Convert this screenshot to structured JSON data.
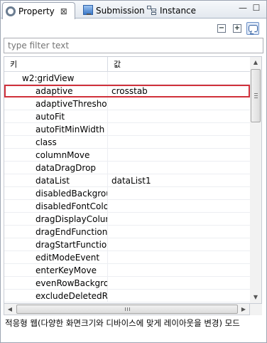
{
  "tabs": [
    {
      "label": "Property",
      "icon": "gear-icon",
      "active": true,
      "close": "⊠"
    },
    {
      "label": "Submission",
      "icon": "monitor-icon",
      "active": false
    },
    {
      "label": "Instance",
      "icon": "instance-icon",
      "active": false
    }
  ],
  "window": {
    "minimize": "—",
    "maximize": "☐"
  },
  "toolbar": {
    "collapse": "−",
    "expand": "+"
  },
  "filter": {
    "placeholder": "type filter text"
  },
  "table": {
    "headers": {
      "key": "키",
      "value": "값"
    },
    "group": "w2:gridView",
    "rows": [
      {
        "key": "adaptive",
        "value": "crosstab"
      },
      {
        "key": "adaptiveThreshold",
        "value": ""
      },
      {
        "key": "autoFit",
        "value": ""
      },
      {
        "key": "autoFitMinWidth",
        "value": ""
      },
      {
        "key": "class",
        "value": ""
      },
      {
        "key": "columnMove",
        "value": ""
      },
      {
        "key": "dataDragDrop",
        "value": ""
      },
      {
        "key": "dataList",
        "value": "dataList1"
      },
      {
        "key": "disabledBackgroun",
        "value": ""
      },
      {
        "key": "disabledFontColor",
        "value": ""
      },
      {
        "key": "dragDisplayColum",
        "value": ""
      },
      {
        "key": "dragEndFunction",
        "value": ""
      },
      {
        "key": "dragStartFunction",
        "value": ""
      },
      {
        "key": "editModeEvent",
        "value": ""
      },
      {
        "key": "enterKeyMove",
        "value": ""
      },
      {
        "key": "evenRowBackgrour",
        "value": ""
      },
      {
        "key": "excludeDeletedRov",
        "value": ""
      }
    ],
    "selected_row": "adaptive"
  },
  "scroll": {
    "up": "▲",
    "down": "▼",
    "left": "◀",
    "right": "▶"
  },
  "description": "적응형 웹(다양한 화면크기와 디바이스에 맞게 레이아웃을 변경) 모드",
  "colors": {
    "selection_border": "#d0313b",
    "tab_active_bg": "#ffffff"
  }
}
